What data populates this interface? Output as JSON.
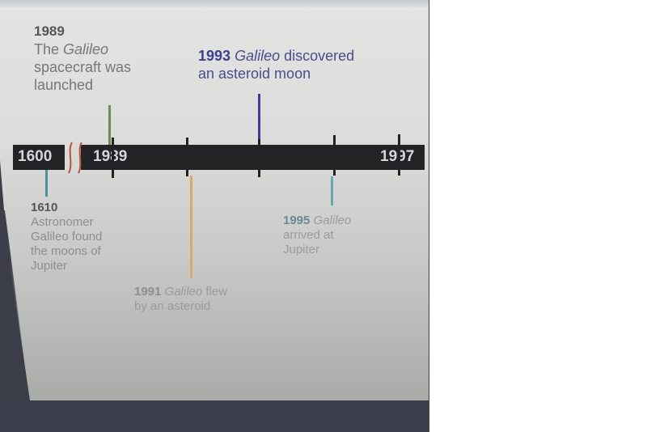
{
  "timeline": {
    "bar_labels": {
      "start": "1600",
      "break_start": "1989",
      "end": "1997"
    },
    "axis_break": true,
    "events": [
      {
        "year": "1989",
        "pre": "",
        "italic": "",
        "line1_rest": "",
        "text": [
          "The ",
          "Galileo",
          "",
          "spacecraft was",
          "launched"
        ],
        "color": "#6f8a5a",
        "position": "above"
      },
      {
        "year": "1993",
        "italic": "Galileo",
        "rest": " discovered",
        "line2": "an asteroid moon",
        "color": "#3d3f8f",
        "position": "above"
      },
      {
        "year": "1610",
        "lines": [
          "Astronomer",
          "Galileo found",
          "the moons of",
          "Jupiter"
        ],
        "color": "#4e8fa0",
        "position": "below"
      },
      {
        "year": "1991",
        "italic": "Galileo",
        "rest": " flew",
        "line2": "by an asteroid",
        "color": "#d8aa6a",
        "position": "below"
      },
      {
        "year": "1995",
        "italic": "Galileo",
        "line2": "arrived at",
        "line3": "Jupiter",
        "color": "#6aa6b2",
        "position": "below"
      }
    ]
  },
  "colors": {
    "bar": "#232326",
    "break_mark": "#b5543f",
    "ev1989": "#6f8a5a",
    "ev1993": "#3d3f8f",
    "ev1610": "#4e8fa0",
    "ev1991": "#d8aa6a",
    "ev1995": "#6aa6b2"
  }
}
